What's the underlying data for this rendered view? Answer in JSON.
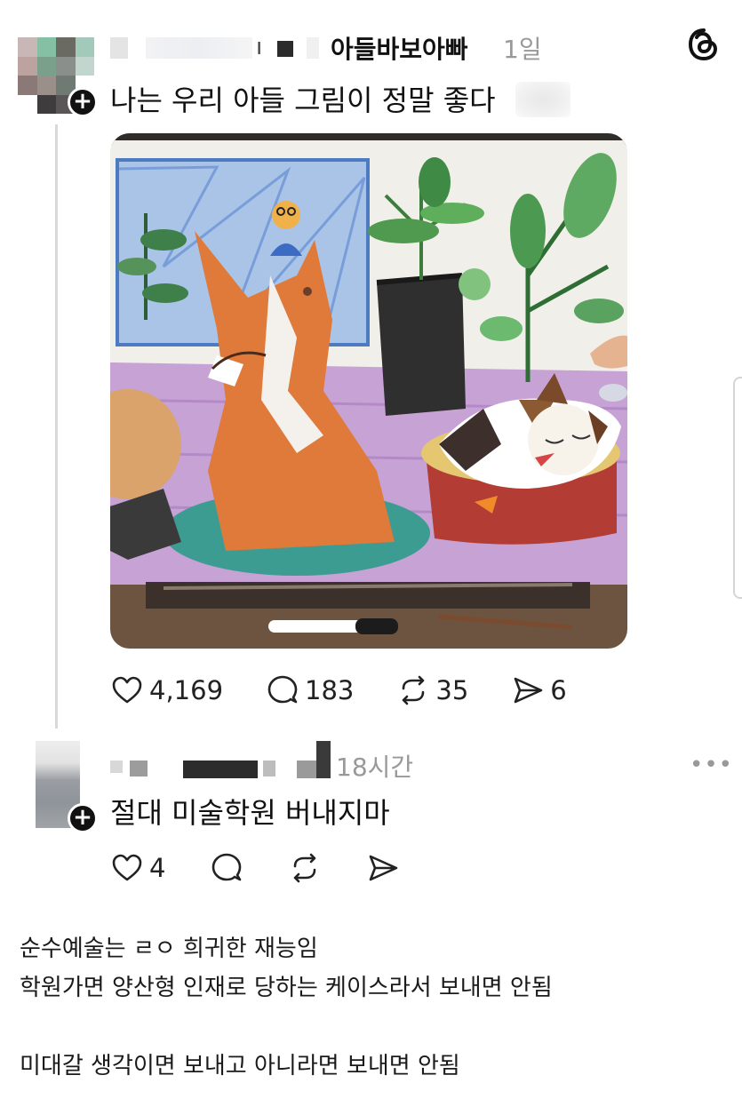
{
  "post": {
    "username": "아들바보아빠",
    "time": "1일",
    "text": "나는 우리 아들 그림이 정말 좋다",
    "blurred_name_glyph": "ı",
    "follow_badge": "+",
    "image_icon": "child-drawing-fox-cat-plants",
    "likes": "4,169",
    "replies": "183",
    "reposts": "35",
    "shares": "6"
  },
  "reply": {
    "time": "18시간",
    "text": "절대 미술학원 버내지마",
    "follow_badge": "+",
    "more": "•••",
    "likes": "4"
  },
  "caption": {
    "line1": "순수예술는 ㄹㅇ 희귀한 재능임",
    "line2": "학원가면 양산형 인재로 당하는 케이스라서 보내면 안됨",
    "line3": "미대갈 생각이면 보내고 아니라면 보내면 안됨"
  },
  "icons": {
    "like": "heart-icon",
    "reply": "comment-icon",
    "repost": "repost-icon",
    "share": "send-icon",
    "app": "threads-logo-icon"
  },
  "colors": {
    "text": "#111111",
    "muted": "#999999",
    "thread_line": "#d9d9d9"
  }
}
